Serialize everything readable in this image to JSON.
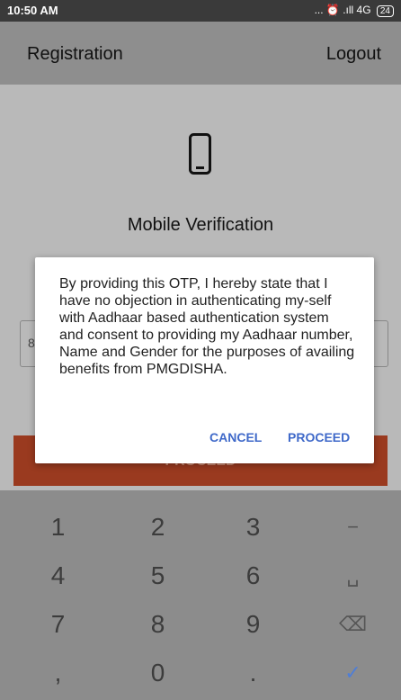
{
  "status_bar": {
    "time": "10:50 AM",
    "icons": "... ⏰ .ıll 4G",
    "battery": "24"
  },
  "app_bar": {
    "title": "Registration",
    "logout": "Logout"
  },
  "content": {
    "icon": "mobile-phone-icon",
    "title": "Mobile Verification",
    "otp_placeholder": "8",
    "proceed_label": "PROCEED"
  },
  "dialog": {
    "message": "By providing this OTP, I hereby state that I have no objection in authenticating my-self with Aadhaar based authentication system and consent to providing my Aadhaar number, Name and Gender for the purposes of availing benefits from PMGDISHA.",
    "cancel_label": "CANCEL",
    "proceed_label": "PROCEED"
  },
  "keypad": {
    "keys": [
      "1",
      "2",
      "3",
      "−",
      "4",
      "5",
      "6",
      "␣",
      "7",
      "8",
      "9",
      "⌫",
      ",",
      "0",
      ".",
      "✓"
    ]
  },
  "colors": {
    "accent": "#3f69c9",
    "proceed_bar": "#9a3a1f",
    "keypad_done": "#4f7ed6"
  }
}
